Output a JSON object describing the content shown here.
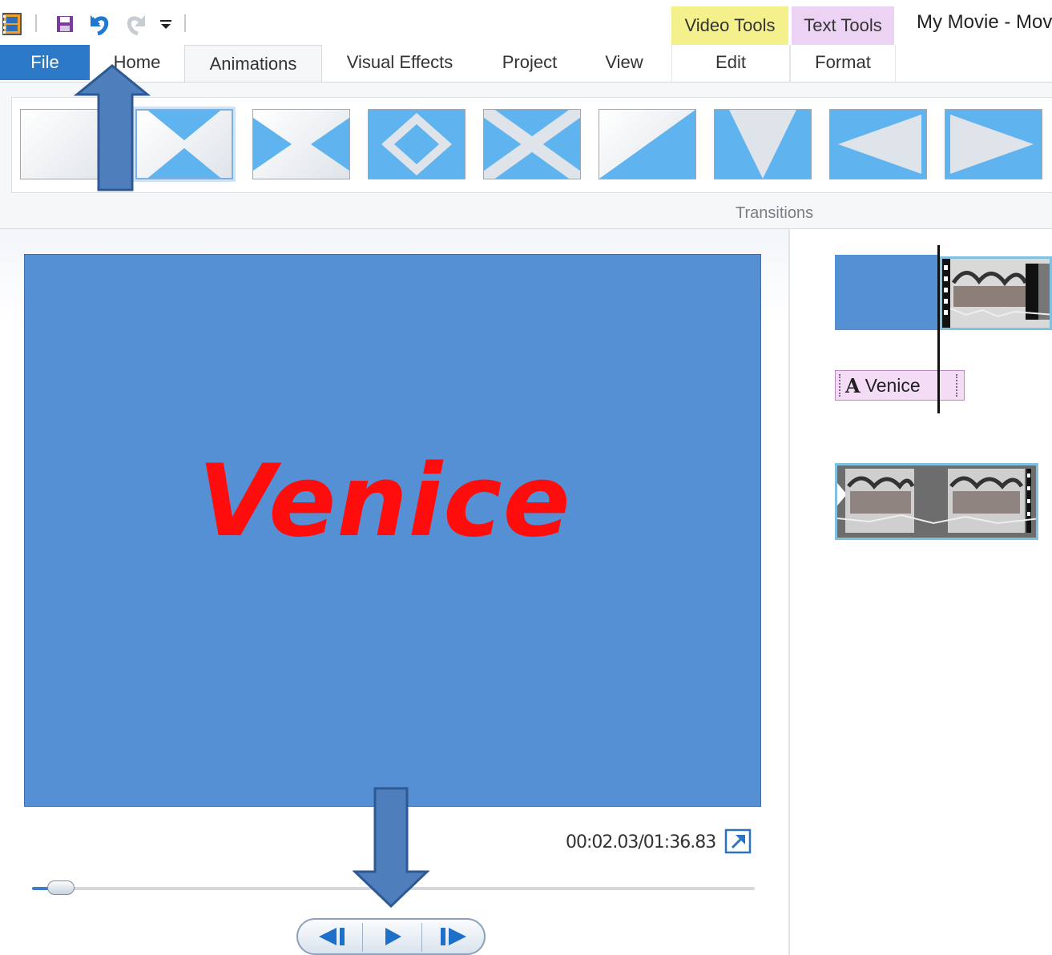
{
  "quick_access": {
    "icons": [
      "movie-maker-app-icon",
      "save-icon",
      "undo-icon",
      "redo-icon",
      "customize-toolbar-icon"
    ]
  },
  "contextual_tabs": {
    "video_tools": "Video Tools",
    "text_tools": "Text Tools"
  },
  "window": {
    "title": "My Movie - Mov"
  },
  "ribbon_tabs": {
    "file": "File",
    "home": "Home",
    "animations": "Animations",
    "visual_effects": "Visual Effects",
    "project": "Project",
    "view": "View",
    "edit": "Edit",
    "format": "Format",
    "active": "Animations"
  },
  "transitions": {
    "group_label": "Transitions",
    "selected_index": 1,
    "items": [
      "none",
      "crossfade",
      "diagonal-box",
      "diamond",
      "cross",
      "diagonal-wipe",
      "v-wipe",
      "left-arrow",
      "right-arrow"
    ],
    "colors": {
      "fill": "#5fb3ef",
      "selected_border": "#7fb0e2"
    }
  },
  "preview": {
    "title_text": "Venice",
    "background": "#5590d4",
    "title_color": "#ff0d0d",
    "time_readout": "00:02.03/01:36.83",
    "progress": 0.021
  },
  "playback": {
    "buttons": [
      "previous-frame-icon",
      "play-icon",
      "next-frame-icon"
    ]
  },
  "storyboard": {
    "caption_icon": "A",
    "caption_text": "Venice",
    "clip_border": "#7fc1de"
  },
  "annotations": {
    "arrow_color": "#4f7ebc",
    "arrows": [
      "up-arrow-pointing-to-file-menu",
      "down-arrow-pointing-to-play-button"
    ]
  }
}
